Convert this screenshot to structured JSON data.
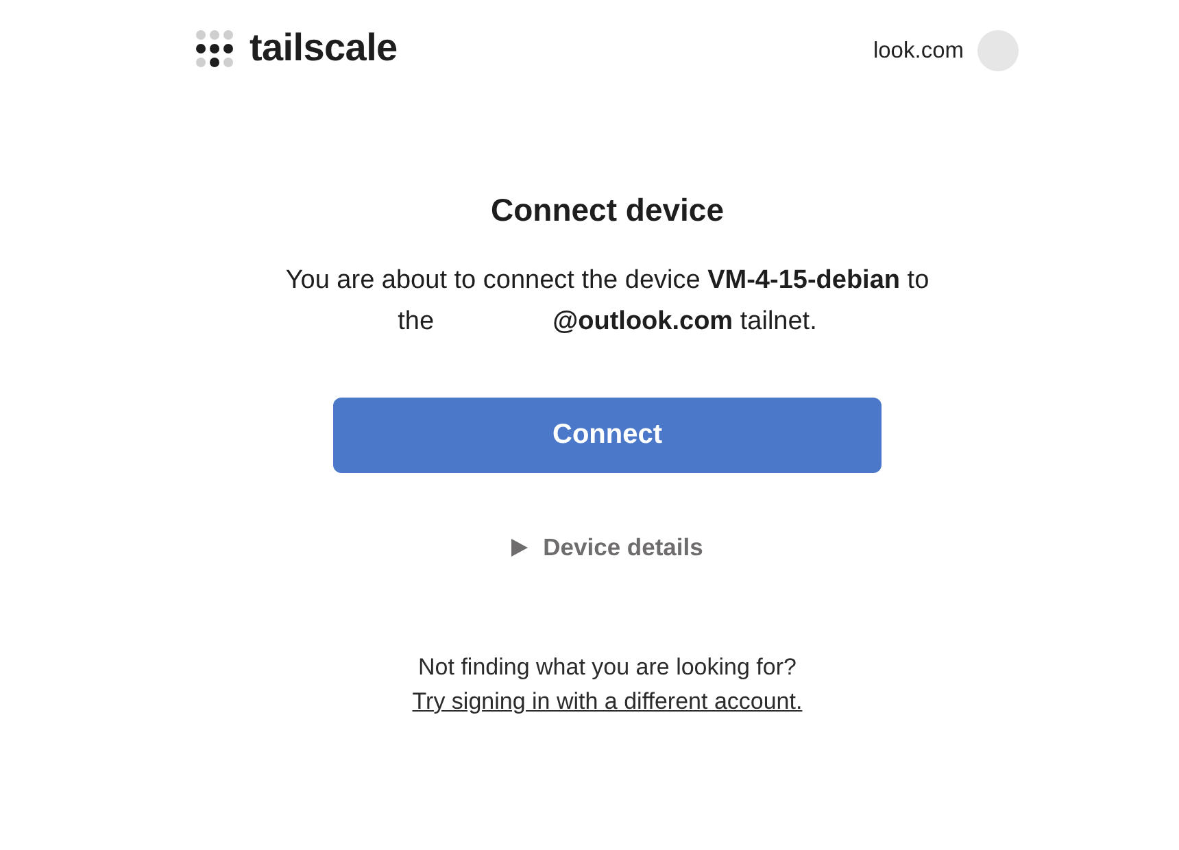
{
  "header": {
    "logo": {
      "wordmark": "tailscale"
    },
    "account": {
      "label": "look.com"
    }
  },
  "main": {
    "title": "Connect device",
    "message": {
      "before": "You are about to connect the device **VM-4-15-debian** to the",
      "after": "**@outlook.com** tailnet."
    },
    "connect_button": "Connect",
    "details": {
      "label": "Device details",
      "expanded": false
    }
  },
  "footer": {
    "question": "Not finding what you are looking for?",
    "link": "Try signing in with a different account."
  }
}
